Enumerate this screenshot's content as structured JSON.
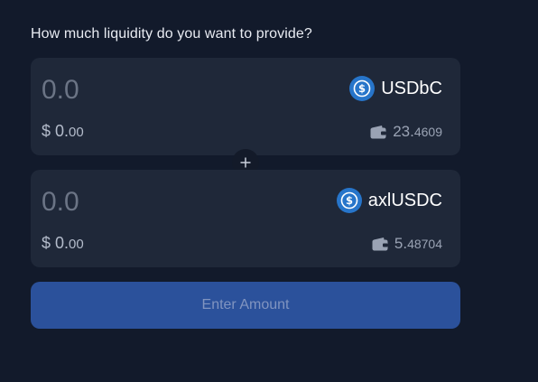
{
  "question": "How much liquidity do you want to provide?",
  "pool": [
    {
      "amount_placeholder": "0.0",
      "token_symbol": "USDbC",
      "usd_prefix": "$ 0.",
      "usd_suffix": "00",
      "balance_main": "23.",
      "balance_decimals": "4609"
    },
    {
      "amount_placeholder": "0.0",
      "token_symbol": "axlUSDC",
      "usd_prefix": "$ 0.",
      "usd_suffix": "00",
      "balance_main": "5.",
      "balance_decimals": "48704"
    }
  ],
  "submit_label": "Enter Amount",
  "colors": {
    "background": "#121a2b",
    "card": "#1f2839",
    "token_icon": "#2775ca",
    "button": "#2b519b"
  },
  "icons": {
    "token": "usdc-coin-icon",
    "balance": "wallet-icon",
    "separator": "plus-icon"
  }
}
